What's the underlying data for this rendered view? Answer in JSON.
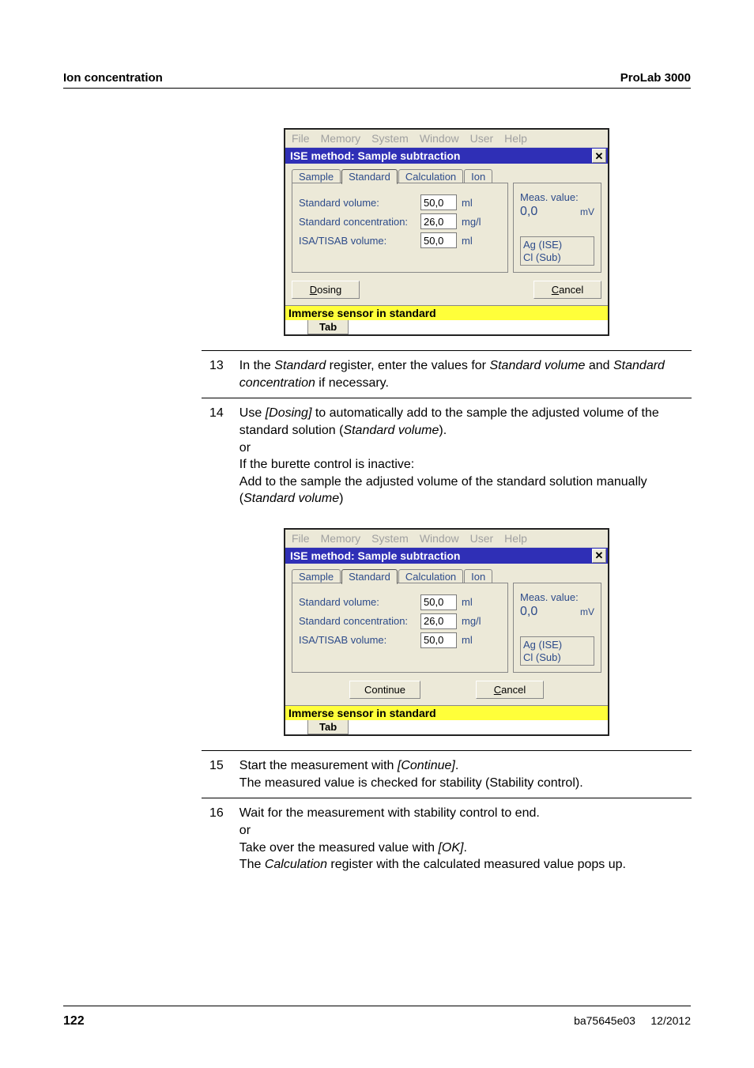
{
  "header": {
    "left": "Ion concentration",
    "right": "ProLab 3000"
  },
  "footer": {
    "page": "122",
    "doc": "ba75645e03",
    "date": "12/2012"
  },
  "dlg": {
    "menubar": [
      "File",
      "Memory",
      "System",
      "Window",
      "User",
      "Help"
    ],
    "title": "ISE method:  Sample subtraction",
    "tabs": {
      "sample": "Sample",
      "standard": "Standard",
      "calculation": "Calculation",
      "ion": "Ion"
    },
    "fields": {
      "std_vol_lbl": "Standard volume:",
      "std_vol_val": "50,0",
      "std_vol_unit": "ml",
      "std_conc_lbl": "Standard concentration:",
      "std_conc_val": "26,0",
      "std_conc_unit": "mg/l",
      "isa_lbl": "ISA/TISAB volume:",
      "isa_val": "50,0",
      "isa_unit": "ml"
    },
    "meas": {
      "label": "Meas. value:",
      "value": "0,0",
      "unit": "mV",
      "sensor1": "Ag (ISE)",
      "sensor2": "Cl (Sub)"
    },
    "buttons": {
      "dosing": "Dosing",
      "continue": "Continue",
      "cancel": "Cancel",
      "dosing_u": "D",
      "cancel_u": "C"
    },
    "status": "Immerse sensor in standard",
    "tabfoot": "Tab"
  },
  "steps1": {
    "r13_num": "13",
    "r13_a": "In the ",
    "r13_b": "Standard",
    "r13_c": " register, enter the values for ",
    "r13_d": "Standard volume",
    "r13_e": " and ",
    "r13_f": "Standard concentration",
    "r13_g": " if necessary.",
    "r14_num": "14",
    "r14_a": "Use ",
    "r14_b": "[Dosing]",
    "r14_c": " to automatically add to the sample the adjusted volume of the standard solution (",
    "r14_d": "Standard volume",
    "r14_e": ").",
    "r14_f": "or",
    "r14_g": "If the burette control is inactive:",
    "r14_h": "Add to the sample the adjusted volume of the standard solution manually (",
    "r14_i": "Standard volume",
    "r14_j": ")"
  },
  "steps2": {
    "r15_num": "15",
    "r15_a": "Start the measurement with ",
    "r15_b": "[Continue]",
    "r15_c": ".",
    "r15_d": "The measured value is checked for stability (Stability control).",
    "r16_num": "16",
    "r16_a": "Wait for the measurement with stability control to end.",
    "r16_b": "or",
    "r16_c": "Take over the measured value with ",
    "r16_d": "[OK]",
    "r16_e": ".",
    "r16_f": "The ",
    "r16_g": "Calculation",
    "r16_h": " register with the calculated measured value pops up."
  }
}
